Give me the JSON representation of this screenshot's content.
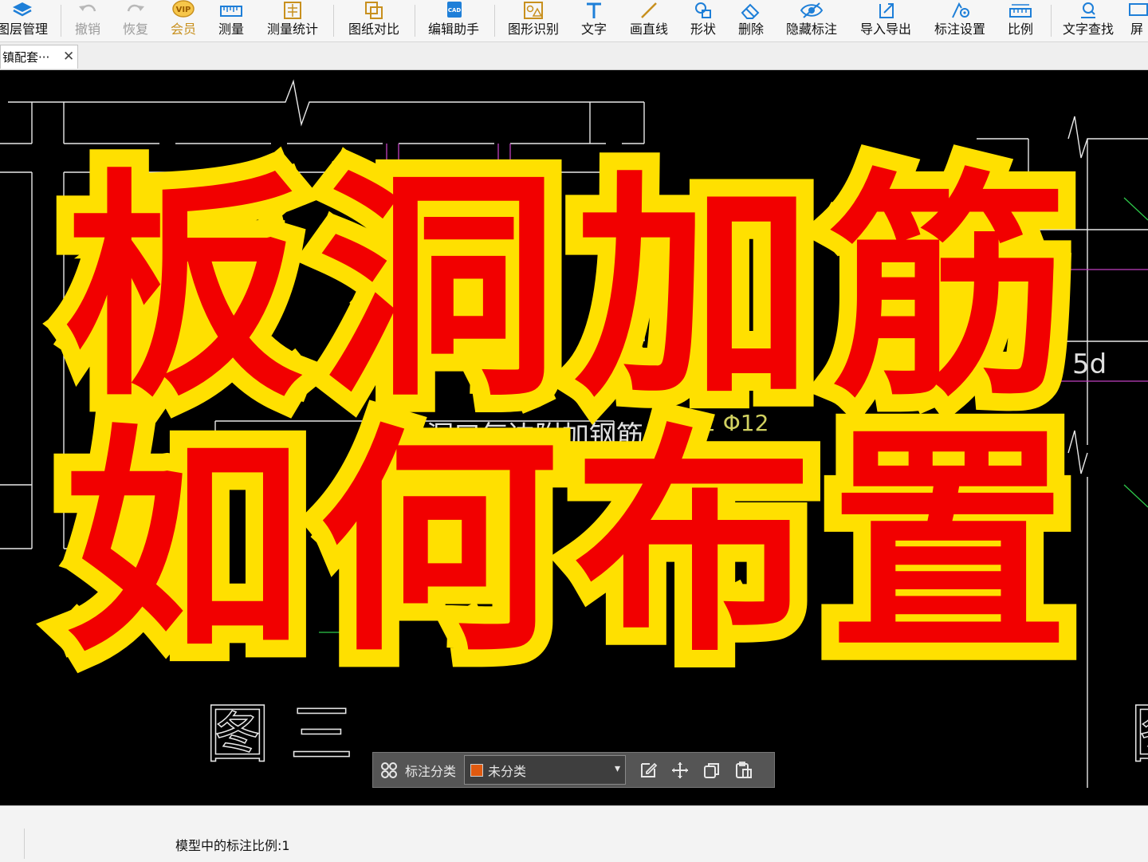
{
  "toolbar": {
    "items": [
      {
        "label": "图层管理",
        "icon": "layers-icon"
      },
      {
        "label": "撤销",
        "icon": "undo-icon",
        "disabled": true
      },
      {
        "label": "恢复",
        "icon": "redo-icon",
        "disabled": true
      },
      {
        "label": "会员",
        "icon": "vip-badge-icon",
        "vip": true
      },
      {
        "label": "测量",
        "icon": "ruler-icon"
      },
      {
        "label": "测量统计",
        "icon": "measure-stats-icon"
      },
      {
        "label": "图纸对比",
        "icon": "compare-drawings-icon"
      },
      {
        "label": "编辑助手",
        "icon": "cad-edit-icon"
      },
      {
        "label": "图形识别",
        "icon": "shape-recognize-icon"
      },
      {
        "label": "文字",
        "icon": "text-icon"
      },
      {
        "label": "画直线",
        "icon": "line-icon"
      },
      {
        "label": "形状",
        "icon": "shapes-icon"
      },
      {
        "label": "删除",
        "icon": "eraser-icon"
      },
      {
        "label": "隐藏标注",
        "icon": "eye-hide-icon"
      },
      {
        "label": "导入导出",
        "icon": "import-export-icon"
      },
      {
        "label": "标注设置",
        "icon": "annotation-settings-icon"
      },
      {
        "label": "比例",
        "icon": "scale-ruler-icon"
      },
      {
        "label": "文字查找",
        "icon": "text-search-icon"
      },
      {
        "label": "屏",
        "icon": "screen-icon"
      }
    ],
    "icon_color": "#1e7fd8",
    "vip_color": "#c8901e"
  },
  "tabs": [
    {
      "label": "镇配套···",
      "close": "✕"
    }
  ],
  "overlay": {
    "line1": "板洞加筋",
    "line2": "如何布置",
    "fill_color": "#f20000",
    "outline_color": "#ffe000"
  },
  "cad": {
    "background": "#000000",
    "texts": {
      "fig_label": "图 三",
      "fig_label_right": "图",
      "dim_5d": "5d",
      "annot_1": "洞口每边附加钢筋",
      "annot_2": "2 Φ12"
    }
  },
  "annotation_bar": {
    "category_label": "标注分类",
    "selected_category": "未分类",
    "swatch_color": "#e05a10",
    "caret": "▾"
  },
  "status": {
    "scale_text": "模型中的标注比例:1"
  }
}
